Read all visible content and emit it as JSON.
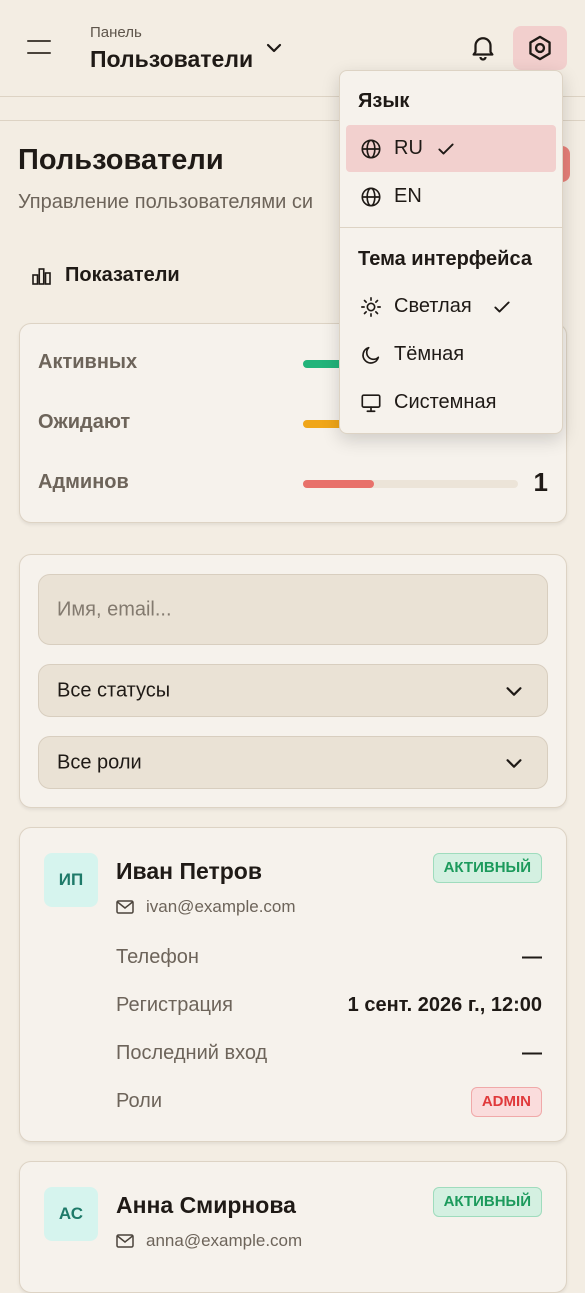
{
  "header": {
    "breadcrumb_parent": "Панель",
    "breadcrumb_current": "Пользователи"
  },
  "page": {
    "title": "Пользователи",
    "subtitle": "Управление пользователями си"
  },
  "metrics": {
    "heading": "Показатели",
    "rows": [
      {
        "label": "Активных",
        "color": "#22b47a",
        "fill": 0.5,
        "count": ""
      },
      {
        "label": "Ожидают",
        "color": "#f0a619",
        "fill": 0.5,
        "count": ""
      },
      {
        "label": "Админов",
        "color": "#e8716a",
        "fill": 0.33,
        "count": "1"
      }
    ]
  },
  "filters": {
    "search_placeholder": "Имя, email...",
    "status_value": "Все статусы",
    "role_value": "Все роли"
  },
  "users": [
    {
      "initials": "ИП",
      "name": "Иван Петров",
      "email": "ivan@example.com",
      "status": "АКТИВНЫЙ",
      "phone_label": "Телефон",
      "phone_value": "—",
      "registered_label": "Регистрация",
      "registered_value": "1 сент. 2026 г., 12:00",
      "last_login_label": "Последний вход",
      "last_login_value": "—",
      "roles_label": "Роли",
      "role_badge": "ADMIN"
    },
    {
      "initials": "АС",
      "name": "Анна Смирнова",
      "email": "anna@example.com",
      "status": "АКТИВНЫЙ"
    }
  ],
  "settings_menu": {
    "language_title": "Язык",
    "lang_ru": "RU",
    "lang_en": "EN",
    "selected_language": "RU",
    "theme_title": "Тема интерфейса",
    "theme_light": "Светлая",
    "theme_dark": "Тёмная",
    "theme_system": "Системная",
    "selected_theme": "Светлая"
  },
  "colors": {
    "accent": "#e8716a",
    "active_green": "#1c9a5c",
    "admin_red": "#e0393b"
  }
}
